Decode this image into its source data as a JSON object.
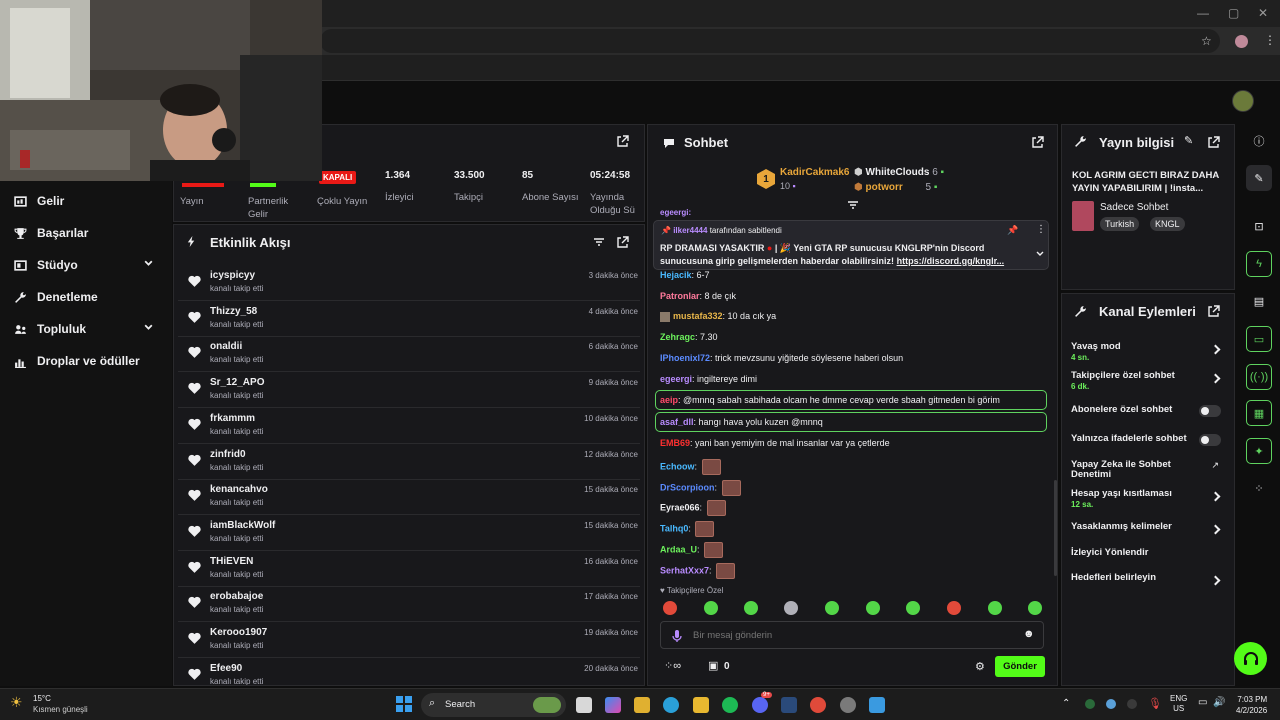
{
  "browser": {
    "window_controls": [
      "—",
      "▢",
      "✕"
    ]
  },
  "left_nav": {
    "items": [
      {
        "label": "Gelir",
        "icon": "revenue-icon",
        "chevron": false
      },
      {
        "label": "Başarılar",
        "icon": "trophy-icon",
        "chevron": false
      },
      {
        "label": "Stüdyo",
        "icon": "studio-icon",
        "chevron": true
      },
      {
        "label": "Denetleme",
        "icon": "wrench-icon",
        "chevron": false
      },
      {
        "label": "Topluluk",
        "icon": "community-icon",
        "chevron": true
      },
      {
        "label": "Droplar ve ödüller",
        "icon": "drops-icon",
        "chevron": false
      }
    ]
  },
  "stats": {
    "items": [
      {
        "value": "",
        "label": "Yayın"
      },
      {
        "value": "",
        "label": "Partnerlik Gelir"
      },
      {
        "value": "KAPALI",
        "label": "Çoklu Yayın"
      },
      {
        "value": "1.364",
        "label": "İzleyici"
      },
      {
        "value": "33.500",
        "label": "Takipçi"
      },
      {
        "value": "85",
        "label": "Abone Sayısı"
      },
      {
        "value": "05:24:58",
        "label": "Yayında Olduğu Sü"
      }
    ]
  },
  "activity_feed": {
    "title": "Etkinlik Akışı",
    "items": [
      {
        "user": "icyspicyy",
        "action": "kanalı takip etti",
        "time": "3 dakika önce"
      },
      {
        "user": "Thizzy_58",
        "action": "kanalı takip etti",
        "time": "4 dakika önce"
      },
      {
        "user": "onaldii",
        "action": "kanalı takip etti",
        "time": "6 dakika önce"
      },
      {
        "user": "Sr_12_APO",
        "action": "kanalı takip etti",
        "time": "9 dakika önce"
      },
      {
        "user": "frkammm",
        "action": "kanalı takip etti",
        "time": "10 dakika önce"
      },
      {
        "user": "zinfrid0",
        "action": "kanalı takip etti",
        "time": "12 dakika önce"
      },
      {
        "user": "kenancahvo",
        "action": "kanalı takip etti",
        "time": "15 dakika önce"
      },
      {
        "user": "iamBlackWolf",
        "action": "kanalı takip etti",
        "time": "15 dakika önce"
      },
      {
        "user": "THiEVEN",
        "action": "kanalı takip etti",
        "time": "16 dakika önce"
      },
      {
        "user": "erobabajoe",
        "action": "kanalı takip etti",
        "time": "17 dakika önce"
      },
      {
        "user": "Kerooo1907",
        "action": "kanalı takip etti",
        "time": "19 dakika önce"
      },
      {
        "user": "Efee90",
        "action": "kanalı takip etti",
        "time": "20 dakika önce"
      }
    ]
  },
  "chat": {
    "title": "Sohbet",
    "leaderboard": {
      "first": {
        "rank": "1",
        "name": "KadirCakmak6",
        "count": "10"
      },
      "second": {
        "name": "WhiiteClouds",
        "count": "6"
      },
      "third": {
        "name": "potworr",
        "count": "5"
      }
    },
    "partial_user": "egeergi:",
    "pinned": {
      "by_user": "ilker4444",
      "by_text": "tarafından sabitlendi",
      "text": "RP DRAMASI YASAKTIR",
      "text2": "| 🎉 Yeni GTA RP sunucusu KNGLRP'nin Discord sunucusuna girip gelişmelerden haberdar olabilirsiniz!",
      "link": "https://discord.gg/knglr..."
    },
    "messages": [
      {
        "user": "Hejacik",
        "text": "6-7",
        "color": "#49b9ff"
      },
      {
        "user": "Patronlar",
        "text": "8 de çık",
        "color": "#ff7a9c"
      },
      {
        "user": "mustafa332",
        "text": "10 da cık ya",
        "color": "#e8b64a"
      },
      {
        "user": "Zehragc",
        "text": "7.30",
        "color": "#6cf05c"
      },
      {
        "user": "IPhoenixl72",
        "text": "trick mevzsunu yiğitede söylesene haberi olsun",
        "color": "#5b8bff"
      },
      {
        "user": "egeergi",
        "text": "ingiltereye dimi",
        "color": "#b98cff"
      },
      {
        "user": "aeip",
        "text": "@mnnq sabah sabihada olcam he dmme cevap verde sbaah gitmeden bi görim",
        "color": "#ff4a6a"
      },
      {
        "user": "asaf_dll",
        "text": "hangı hava yolu kuzen @mnnq",
        "color": "#b98cff"
      },
      {
        "user": "EMB69",
        "text": "yani ban yemiyim de mal insanlar var ya çetlerde",
        "color": "#ff3030"
      },
      {
        "user": "Echoow",
        "text": "",
        "color": "#49b9ff"
      },
      {
        "user": "DrScorpioon",
        "text": "",
        "color": "#5b8bff"
      },
      {
        "user": "Eyrae066",
        "text": "",
        "color": "#efeff1"
      },
      {
        "user": "Talhq0",
        "text": "",
        "color": "#49b9ff"
      },
      {
        "user": "Ardaa_U",
        "text": "",
        "color": "#6cf05c"
      },
      {
        "user": "SerhatXxx7",
        "text": "",
        "color": "#b98cff"
      }
    ],
    "followers_only": "Takipçilere Özel",
    "input_placeholder": "Bir mesaj gönderin",
    "points": "0",
    "send_label": "Gönder"
  },
  "stream_info": {
    "title": "Yayın bilgisi",
    "stream_title": "KOL AGRIM GECTI BIRAZ DAHA YAYIN YAPABILIRIM | !insta...",
    "category": "Sadece Sohbet",
    "tags": [
      "Turkish",
      "KNGL"
    ]
  },
  "channel_actions": {
    "title": "Kanal Eylemleri",
    "items": [
      {
        "label": "Yavaş mod",
        "sub": "4 sn.",
        "control": "chevron"
      },
      {
        "label": "Takipçilere özel sohbet",
        "sub": "6 dk.",
        "control": "chevron"
      },
      {
        "label": "Abonelere özel sohbet",
        "sub": "",
        "control": "toggle"
      },
      {
        "label": "Yalnızca ifadelerle sohbet",
        "sub": "",
        "control": "toggle"
      },
      {
        "label": "Yapay Zeka ile Sohbet Denetimi",
        "sub": "",
        "control": "external"
      },
      {
        "label": "Hesap yaşı kısıtlaması",
        "sub": "12 sa.",
        "control": "chevron"
      },
      {
        "label": "Yasaklanmış kelimeler",
        "sub": "",
        "control": "chevron"
      },
      {
        "label": "İzleyici Yönlendir",
        "sub": "",
        "control": "none"
      },
      {
        "label": "Hedefleri belirleyin",
        "sub": "",
        "control": "chevron"
      }
    ]
  },
  "taskbar": {
    "weather_temp": "15°C",
    "weather_desc": "Kısmen güneşli",
    "search_label": "Search",
    "lang": "ENG",
    "region": "US",
    "time": "7:03 PM",
    "date": "4/2/2026",
    "discord_badge": "9+"
  },
  "colors": {
    "accent_green": "#53fc18",
    "panel_bg": "#18181b",
    "page_bg": "#0e0e0e"
  }
}
